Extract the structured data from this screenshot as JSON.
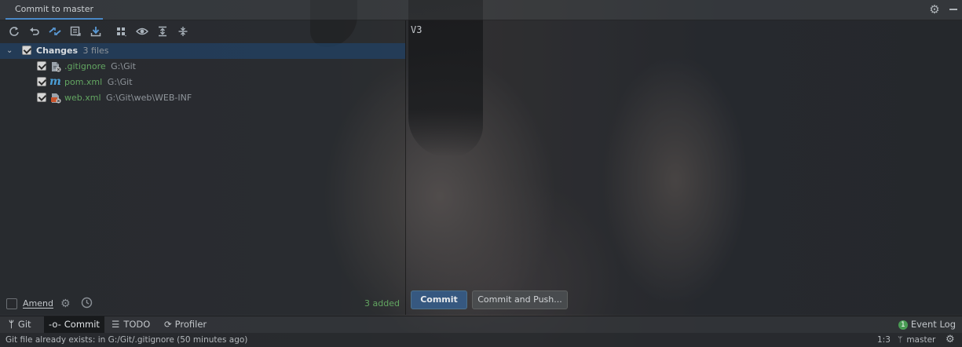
{
  "tab": {
    "label": "Commit to master"
  },
  "toolbar": {
    "buttons": [
      "refresh-icon",
      "rollback-icon",
      "diff-icon",
      "shelve-icon",
      "update-icon",
      "group-by-icon",
      "eye-icon",
      "expand-all-icon",
      "collapse-all-icon"
    ]
  },
  "tree": {
    "root": {
      "label": "Changes",
      "count": "3 files"
    },
    "files": [
      {
        "name": ".gitignore",
        "path": "G:\\Git",
        "icon": "gitignore-file-icon"
      },
      {
        "name": "pom.xml",
        "path": "G:\\Git",
        "icon": "maven-file-icon"
      },
      {
        "name": "web.xml",
        "path": "G:\\Git\\web\\WEB-INF",
        "icon": "xml-file-icon"
      }
    ]
  },
  "left_bottom": {
    "amend_label": "Amend",
    "added": "3 added"
  },
  "commit_message": "V3",
  "buttons": {
    "commit": "Commit",
    "commit_and_push": "Commit and Push..."
  },
  "bottom_tabs": {
    "git": "Git",
    "commit": "Commit",
    "todo": "TODO",
    "profiler": "Profiler",
    "event_log": "Event Log",
    "event_count": "1"
  },
  "status": {
    "message": "Git file already exists: in G:/Git/.gitignore (50 minutes ago)",
    "position": "1:3",
    "branch": "master"
  },
  "colors": {
    "accent": "#4a88c7",
    "primary_button": "#365880",
    "added_green": "#62a561"
  }
}
